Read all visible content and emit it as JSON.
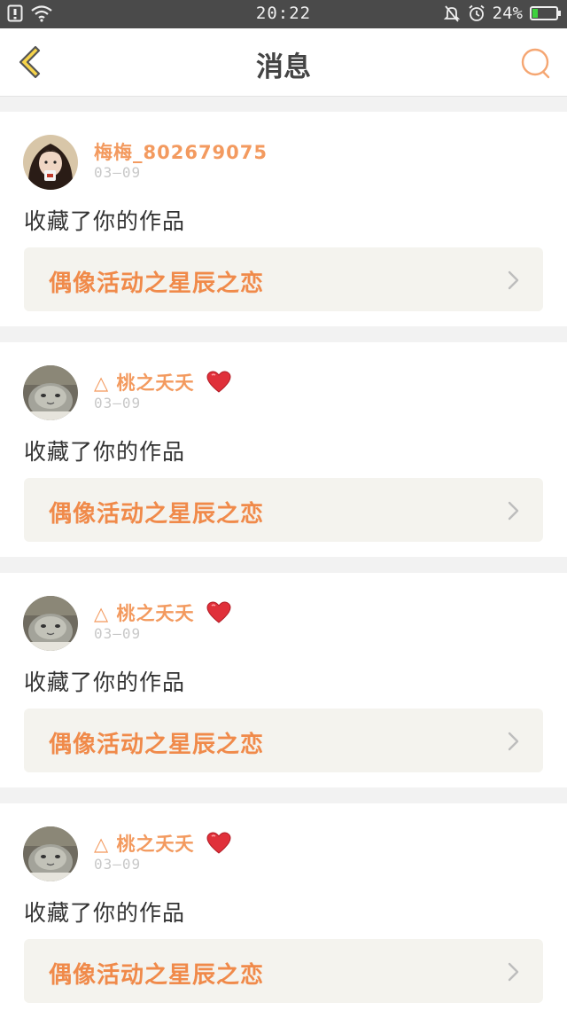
{
  "status_bar": {
    "time": "20:22",
    "battery": "24%",
    "battery_level": 0.24,
    "icons": [
      "sim-icon",
      "wifi-icon",
      "mute-bell-icon",
      "alarm-icon",
      "battery-icon"
    ]
  },
  "header": {
    "title": "消息",
    "back_icon": "chevron-left-icon",
    "search_icon": "search-icon"
  },
  "colors": {
    "accent": "#f39a5f",
    "work_title": "#f08a4a",
    "back_fill": "#f7d44a",
    "heart": "#e0303a"
  },
  "messages": [
    {
      "username": "梅梅_802679075",
      "has_heart": false,
      "date": "03—09",
      "action": "收藏了你的作品",
      "work_title": "偶像活动之星辰之恋",
      "avatar": "girl-avatar"
    },
    {
      "username": "△ 桃之夭夭",
      "has_heart": true,
      "date": "03—09",
      "action": "收藏了你的作品",
      "work_title": "偶像活动之星辰之恋",
      "avatar": "cat-avatar"
    },
    {
      "username": "△ 桃之夭夭",
      "has_heart": true,
      "date": "03—09",
      "action": "收藏了你的作品",
      "work_title": "偶像活动之星辰之恋",
      "avatar": "cat-avatar"
    },
    {
      "username": "△ 桃之夭夭",
      "has_heart": true,
      "date": "03—09",
      "action": "收藏了你的作品",
      "work_title": "偶像活动之星辰之恋",
      "avatar": "cat-avatar"
    }
  ]
}
